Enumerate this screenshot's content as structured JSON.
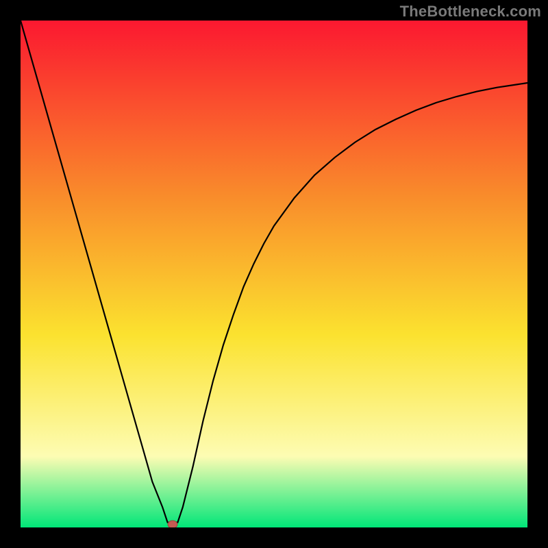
{
  "watermark": "TheBottleneck.com",
  "colors": {
    "frame": "#000000",
    "curve": "#000000",
    "marker_fill": "#c45a52",
    "marker_stroke": "#9a423b",
    "gradient_top": "#fb1830",
    "gradient_mid_upper": "#f98d2b",
    "gradient_mid": "#fbe22f",
    "gradient_mid_lower": "#fdfcb3",
    "gradient_bottom": "#00e678"
  },
  "chart_data": {
    "type": "line",
    "title": "",
    "xlabel": "",
    "ylabel": "",
    "xlim": [
      0,
      100
    ],
    "ylim": [
      0,
      100
    ],
    "grid": false,
    "legend": false,
    "x": [
      0,
      2,
      4,
      6,
      8,
      10,
      12,
      14,
      16,
      18,
      20,
      22,
      24,
      26,
      28,
      29,
      30,
      31,
      32,
      34,
      36,
      38,
      40,
      42,
      44,
      46,
      48,
      50,
      54,
      58,
      62,
      66,
      70,
      74,
      78,
      82,
      86,
      90,
      94,
      98,
      100
    ],
    "series": [
      {
        "name": "curve",
        "values": [
          100,
          93,
          86,
          79,
          72,
          65,
          58,
          51,
          44,
          37,
          30,
          23,
          16,
          9,
          4,
          1,
          1,
          1,
          4,
          12,
          21,
          29,
          36,
          42,
          47.5,
          52,
          56,
          59.5,
          65,
          69.5,
          73,
          76,
          78.5,
          80.5,
          82.3,
          83.8,
          85,
          86,
          86.8,
          87.4,
          87.7
        ]
      }
    ],
    "marker": {
      "x": 30,
      "y": 0.6
    },
    "background_gradient_stops": [
      {
        "pos": 0.0,
        "color": "#fb1830"
      },
      {
        "pos": 0.35,
        "color": "#f98d2b"
      },
      {
        "pos": 0.62,
        "color": "#fbe22f"
      },
      {
        "pos": 0.86,
        "color": "#fdfcb3"
      },
      {
        "pos": 1.0,
        "color": "#00e678"
      }
    ]
  }
}
